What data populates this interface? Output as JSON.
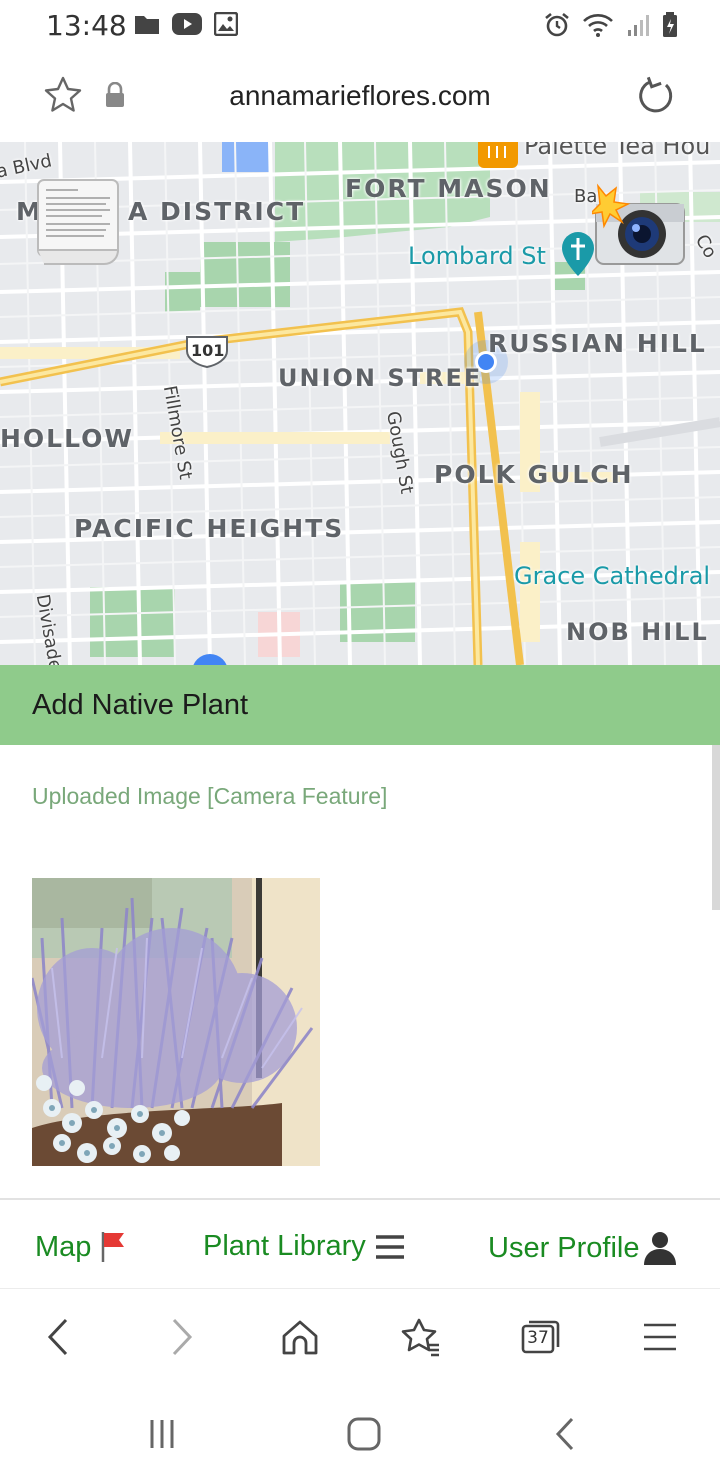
{
  "status_bar": {
    "time": "13:48",
    "left_icons": [
      "folder-icon",
      "youtube-icon",
      "image-icon"
    ],
    "right_icons": [
      "alarm-icon",
      "wifi-icon",
      "signal-icon",
      "battery-icon"
    ]
  },
  "browser": {
    "url": "annamarieflores.com",
    "tab_count": "37"
  },
  "map": {
    "neighborhoods": [
      "FORT MASON",
      "MARINA DISTRICT",
      "RUSSIAN HILL",
      "UNION STREET",
      "HOLLOW",
      "POLK GULCH",
      "PACIFIC HEIGHTS",
      "NOB HILL"
    ],
    "marina_label_left": "M",
    "marina_label_right": "A DISTRICT",
    "union_label": "UNION STREE",
    "streets": [
      "a Blvd",
      "Fillmore St",
      "Gough St",
      "Divisade"
    ],
    "pois": [
      "Lombard St",
      "Grace Cathedral",
      "Palette Tea Hou",
      "Ba",
      "Co"
    ],
    "highway": "101"
  },
  "add_plant": {
    "title": "Add Native Plant",
    "upload_label": "Uploaded Image [Camera Feature]"
  },
  "app_nav": {
    "map": "Map",
    "library": "Plant Library",
    "profile": "User Profile"
  }
}
